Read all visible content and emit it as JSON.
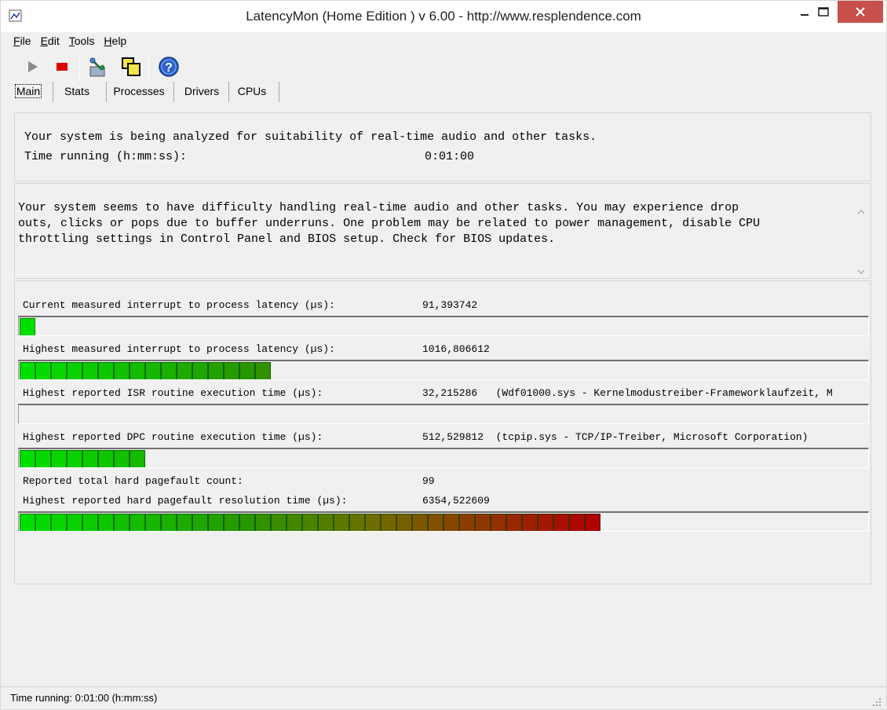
{
  "window": {
    "title": "LatencyMon  (Home Edition )  v 6.00 - http://www.resplendence.com"
  },
  "menu": {
    "items": [
      {
        "key": "F",
        "rest": "ile"
      },
      {
        "key": "E",
        "rest": "dit"
      },
      {
        "key": "T",
        "rest": "ools"
      },
      {
        "key": "H",
        "rest": "elp"
      }
    ]
  },
  "toolbar": {
    "icons": [
      "play-icon",
      "stop-icon",
      "wrench-icon",
      "windows-icon",
      "help-icon"
    ]
  },
  "tabs": [
    "Main",
    "Stats",
    "Processes",
    "Drivers",
    "CPUs"
  ],
  "status_panel": {
    "line1": "Your system is being analyzed for suitability of real-time audio and other tasks.",
    "time_label": "Time running (h:mm:ss):",
    "time_value": "0:01:00"
  },
  "message_panel": {
    "line1": "Your system seems to have difficulty handling real-time audio and other tasks. You may experience drop",
    "line2": "outs, clicks or pops due to buffer underruns. One problem may be related to power management, disable CPU",
    "line3": "throttling settings in Control Panel and BIOS setup. Check for BIOS updates."
  },
  "metrics": {
    "current_latency": {
      "label": "Current measured interrupt to process latency (µs):",
      "value": "91,393742",
      "filled_segments": 1
    },
    "highest_latency": {
      "label": "Highest measured interrupt to process latency (µs):",
      "value": "1016,806612",
      "filled_segments": 16
    },
    "highest_isr": {
      "label": "Highest reported ISR routine execution time (µs):",
      "value": "32,215286   (Wdf01000.sys - Kernelmodustreiber-Frameworklaufzeit, M",
      "filled_segments": 0
    },
    "highest_dpc": {
      "label": "Highest reported DPC routine execution time (µs):",
      "value": "512,529812  (tcpip.sys - TCP/IP-Treiber, Microsoft Corporation)",
      "filled_segments": 8
    },
    "pagefault_count": {
      "label": "Reported total hard pagefault count:",
      "value": "99"
    },
    "pagefault_time": {
      "label": "Highest reported hard pagefault resolution time (µs):",
      "value": "6354,522609",
      "filled_segments": 37
    }
  },
  "statusbar": {
    "text": "Time running: 0:01:00  (h:mm:ss)"
  },
  "colors": {
    "bar_green": "#00e000",
    "bar_red": "#b00000",
    "close_button": "#c7504b"
  }
}
